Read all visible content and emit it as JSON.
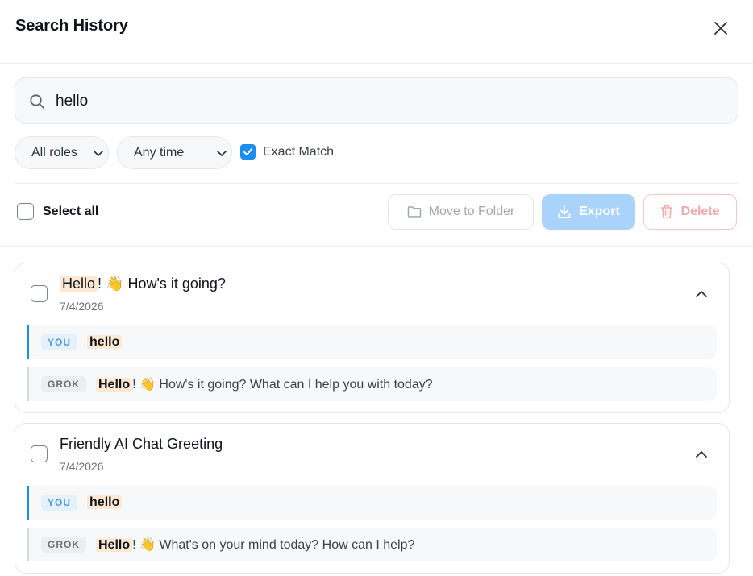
{
  "header": {
    "title": "Search History"
  },
  "search": {
    "value": "hello"
  },
  "filters": {
    "role": {
      "selected": "All roles"
    },
    "time": {
      "selected": "Any time"
    },
    "exact_match": {
      "label": "Exact Match",
      "checked": true
    }
  },
  "toolbar": {
    "select_all_label": "Select all",
    "move_label": "Move to Folder",
    "export_label": "Export",
    "delete_label": "Delete"
  },
  "results": [
    {
      "title_highlight": "Hello",
      "title_rest": "! 👋 How's it going?",
      "date": "7/4/2026",
      "messages": [
        {
          "role": "YOU",
          "highlight": "hello",
          "rest": ""
        },
        {
          "role": "GROK",
          "highlight": "Hello",
          "rest": "! 👋 How's it going? What can I help you with today?"
        }
      ]
    },
    {
      "title_highlight": "",
      "title_rest": "Friendly AI Chat Greeting",
      "date": "7/4/2026",
      "messages": [
        {
          "role": "YOU",
          "highlight": "hello",
          "rest": ""
        },
        {
          "role": "GROK",
          "highlight": "Hello",
          "rest": "! 👋 What's on your mind today? How can I help?"
        }
      ]
    }
  ],
  "colors": {
    "accent": "#1d8cf0",
    "highlight": "#fde8d4",
    "delete": "#efaaaa",
    "export_disabled": "#a9d3fb"
  }
}
